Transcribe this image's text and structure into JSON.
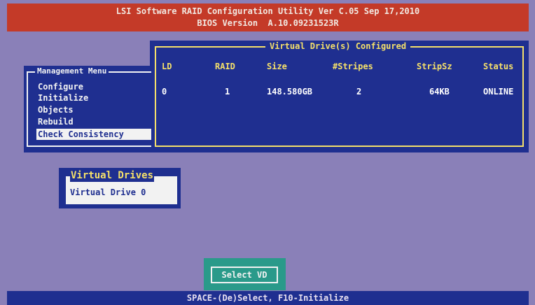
{
  "header": {
    "title": "LSI Software RAID Configuration Utility Ver C.05 Sep 17,2010",
    "bios": "BIOS Version  A.10.09231523R"
  },
  "virtual_drives_configured": {
    "title": "Virtual Drive(s) Configured",
    "columns": [
      "LD",
      "RAID",
      "Size",
      "#Stripes",
      "StripSz",
      "Status"
    ],
    "rows": [
      {
        "ld": "0",
        "raid": "1",
        "size": "148.580GB",
        "stripes": "2",
        "stripsz": "64KB",
        "status": "ONLINE"
      }
    ]
  },
  "management_menu": {
    "title": "Management Menu",
    "items": [
      "Configure",
      "Initialize",
      "Objects",
      "Rebuild",
      "Check Consistency"
    ],
    "selected_index": 4
  },
  "virtual_drives": {
    "title": "Virtual Drives",
    "items": [
      "Virtual Drive 0"
    ]
  },
  "select_vd_label": "Select VD",
  "footer": "SPACE-(De)Select, F10-Initialize",
  "colors": {
    "background": "#8a80b8",
    "panel": "#1f2f90",
    "header": "#c43a28",
    "accent_yellow": "#f5e06a",
    "button_bg": "#2a9a8a"
  }
}
